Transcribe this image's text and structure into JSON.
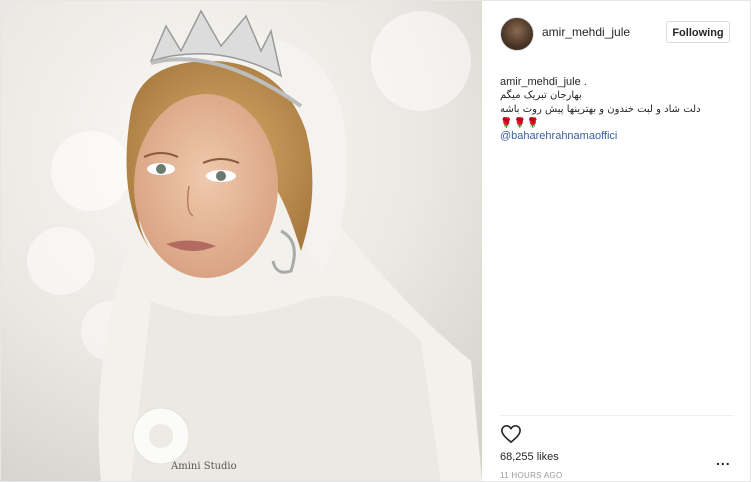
{
  "post": {
    "username": "amir_mehdi_jule",
    "follow_label": "Following",
    "caption_user": "amir_mehdi_jule .",
    "caption_line1": "بهارجان تبریک میگم",
    "caption_line2": "دلت شاد و لبت خندون و بهترینها پیش روت باشه",
    "caption_emoji": "🌹🌹🌹",
    "mention": "@baharehrahnamaoffici",
    "likes": "68,255 likes",
    "time": "11 HOURS AGO",
    "more": "...",
    "watermark": "Amini Studio"
  },
  "icons": {
    "heart": "heart-icon",
    "avatar": "avatar",
    "more": "more-options-icon"
  },
  "colors": {
    "mention": "#3a5f9e",
    "text": "#262626",
    "muted": "#999999",
    "border": "#dbdbdb"
  }
}
